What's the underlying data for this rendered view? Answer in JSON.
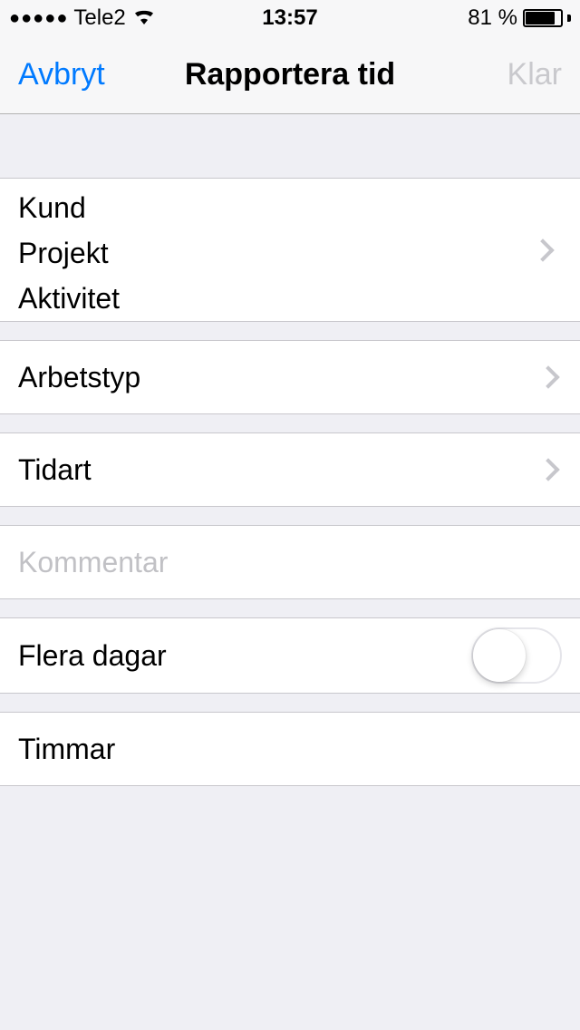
{
  "status": {
    "signal": "●●●●●",
    "carrier": "Tele2",
    "time": "13:57",
    "battery_text": "81 %"
  },
  "nav": {
    "left": "Avbryt",
    "title": "Rapportera tid",
    "right": "Klar"
  },
  "rows": {
    "kund": "Kund",
    "projekt": "Projekt",
    "aktivitet": "Aktivitet",
    "arbetstyp": "Arbetstyp",
    "tidart": "Tidart",
    "kommentar_placeholder": "Kommentar",
    "flera_dagar": "Flera dagar",
    "flera_dagar_on": false,
    "timmar": "Timmar"
  }
}
